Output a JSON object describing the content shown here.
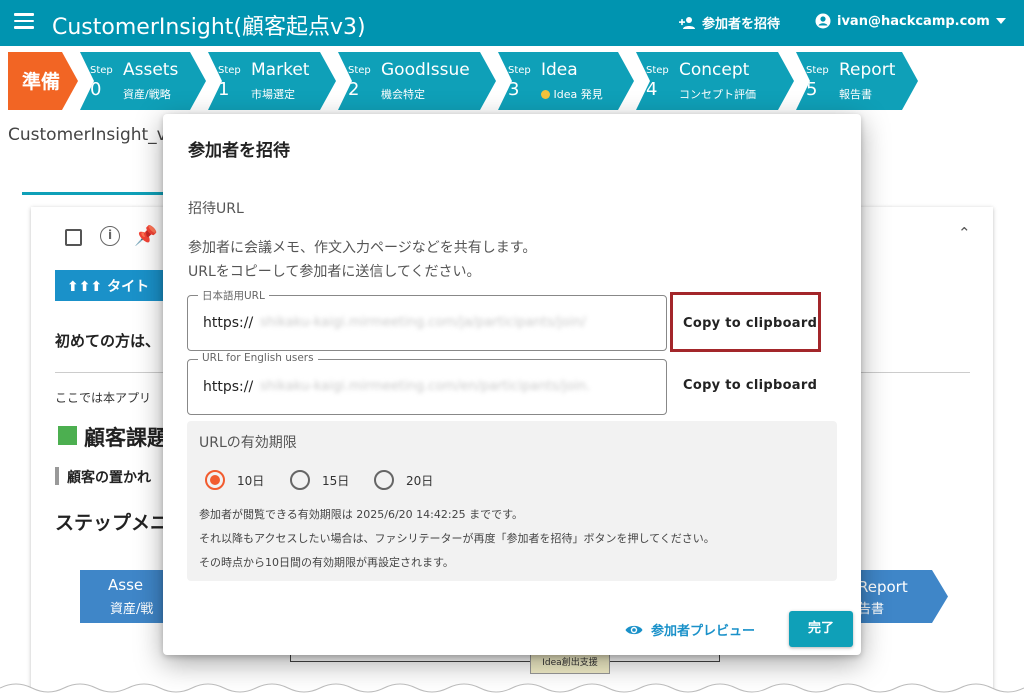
{
  "appbar": {
    "title": "CustomerInsight(顧客起点v3)",
    "invite_label": "参加者を招待",
    "user_email": "ivan@hackcamp.com"
  },
  "stepbar": {
    "prep_label": "準備",
    "step_word": "Step",
    "steps": [
      {
        "num": "0",
        "name": "Assets",
        "sub": "資産/戦略"
      },
      {
        "num": "1",
        "name": "Market",
        "sub": "市場選定"
      },
      {
        "num": "2",
        "name": "GoodIssue",
        "sub": "機会特定"
      },
      {
        "num": "3",
        "name": "Idea",
        "sub": "Idea 発見"
      },
      {
        "num": "4",
        "name": "Concept",
        "sub": "コンセプト評価"
      },
      {
        "num": "5",
        "name": "Report",
        "sub": "報告書"
      }
    ]
  },
  "background": {
    "page_title": "CustomerInsight_v",
    "banner": "⬆⬆⬆ タイト",
    "first_time": "初めての方は、",
    "here_text": "ここでは本アプリ",
    "problem_heading": "顧客課題",
    "situation_text": "顧客の置かれ",
    "step_menu": "ステップメニ",
    "assets_arrow": {
      "line1": "Asse",
      "line2": "資産/戦"
    },
    "report_arrow": {
      "line1": "Report",
      "line2": "告書"
    },
    "flow_box": "Idea創出支援"
  },
  "dialog": {
    "title": "参加者を招待",
    "section_label": "招待URL",
    "description_line1": "参加者に会議メモ、作文入力ページなどを共有します。",
    "description_line2": "URLをコピーして参加者に送信してください。",
    "url_fields": [
      {
        "label": "日本語用URL",
        "prefix": "https://",
        "value": "shikaku-kaigi.mirmeeting.com/ja/participants/join/",
        "copy_label": "Copy to clipboard"
      },
      {
        "label": "URL for English users",
        "prefix": "https://",
        "value": "shikaku-kaigi.mirmeeting.com/en/participants/join.",
        "copy_label": "Copy to clipboard"
      }
    ],
    "expiry": {
      "title": "URLの有効期限",
      "options": [
        "10日",
        "15日",
        "20日"
      ],
      "selected": "10日",
      "note_line1": "参加者が閲覧できる有効期限は 2025/6/20 14:42:25 までです。",
      "note_line2": "それ以降もアクセスしたい場合は、ファシリテーターが再度「参加者を招待」ボタンを押してください。",
      "note_line3": "その時点から10日間の有効期限が再設定されます。"
    },
    "preview_label": "参加者プレビュー",
    "done_label": "完了"
  },
  "colors": {
    "appbar": "#0094b0",
    "step": "#0fa0b8",
    "prep_step": "#f26524",
    "radio_selected": "#f25c2f",
    "highlight_box": "#a3262a",
    "link": "#1a91c9"
  },
  "icons": [
    "menu-icon",
    "add-person-icon",
    "account-circle-icon",
    "caret-down-icon",
    "info-icon",
    "pin-icon",
    "chevron-up-icon",
    "eye-icon",
    "lightbulb-icon"
  ]
}
